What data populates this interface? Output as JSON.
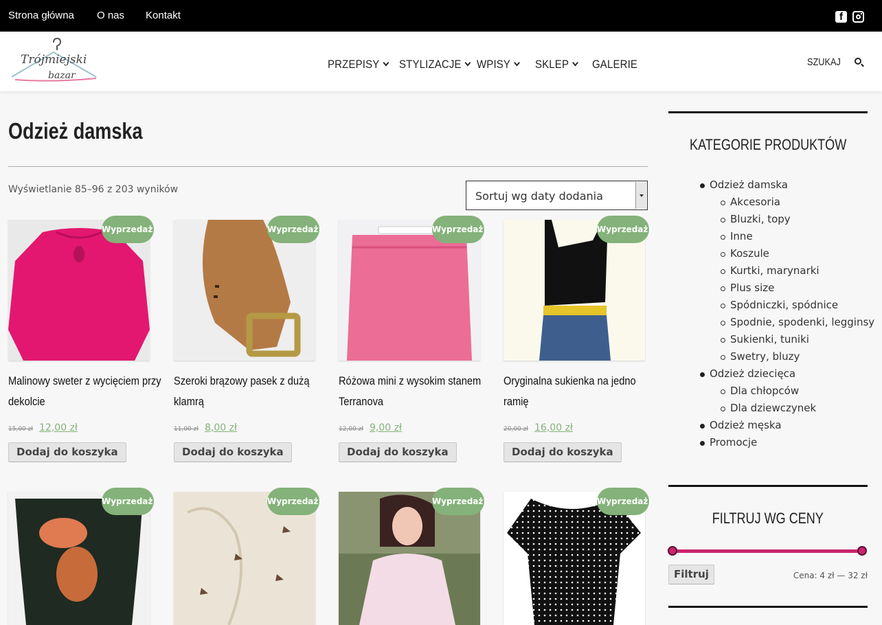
{
  "topbar": {
    "links": [
      "Strona główna",
      "O nas",
      "Kontakt"
    ],
    "social": [
      "facebook-icon",
      "instagram-icon"
    ]
  },
  "header": {
    "logo": {
      "line1": "Trójmiejski",
      "line2": "bazar"
    },
    "nav": [
      "PRZEPISY",
      "STYLIZACJE",
      "WPISY",
      "SKLEP",
      "GALERIE"
    ],
    "search_label": "SZUKAJ"
  },
  "main": {
    "title": "Odzież damska",
    "result_count": "Wyświetlanie 85–96 z 203 wyników",
    "sort_value": "Sortuj wg daty dodania",
    "sale_badge": "Wyprzedaż!",
    "add_to_cart": "Dodaj do koszyka",
    "products": [
      {
        "title_lines": [
          "Malinowy sweter z wycięciem przy",
          "dekolcie"
        ],
        "old_price": "15,00 zł",
        "price": "12,00 zł"
      },
      {
        "title_lines": [
          "Szeroki brązowy pasek z dużą",
          "klamrą"
        ],
        "old_price": "11,00 zł",
        "price": "8,00 zł"
      },
      {
        "title_lines": [
          "Różowa mini z wysokim stanem",
          "Terranova"
        ],
        "old_price": "12,00 zł",
        "price": "9,00 zł"
      },
      {
        "title_lines": [
          "Oryginalna sukienka na jedno",
          "ramię"
        ],
        "old_price": "20,00 zł",
        "price": "16,00 zł"
      },
      {
        "title_lines": [],
        "old_price": "",
        "price": ""
      },
      {
        "title_lines": [],
        "old_price": "",
        "price": ""
      },
      {
        "title_lines": [],
        "old_price": "",
        "price": ""
      },
      {
        "title_lines": [],
        "old_price": "",
        "price": ""
      }
    ]
  },
  "sidebar": {
    "categories_title": "KATEGORIE PRODUKTÓW",
    "categories": [
      {
        "label": "Odzież damska",
        "level": 0
      },
      {
        "label": "Akcesoria",
        "level": 1
      },
      {
        "label": "Bluzki, topy",
        "level": 1
      },
      {
        "label": "Inne",
        "level": 1
      },
      {
        "label": "Koszule",
        "level": 1
      },
      {
        "label": "Kurtki, marynarki",
        "level": 1
      },
      {
        "label": "Plus size",
        "level": 1
      },
      {
        "label": "Spódniczki, spódnice",
        "level": 1
      },
      {
        "label": "Spodnie, spodenki, legginsy",
        "level": 1
      },
      {
        "label": "Sukienki, tuniki",
        "level": 1
      },
      {
        "label": "Swetry, bluzy",
        "level": 1
      },
      {
        "label": "Odzież dziecięca",
        "level": 0
      },
      {
        "label": "Dla chłopców",
        "level": 1
      },
      {
        "label": "Dla dziewczynek",
        "level": 1
      },
      {
        "label": "Odzież męska",
        "level": 0
      },
      {
        "label": "Promocje",
        "level": 0
      }
    ],
    "price_filter_title": "FILTRUJ WG CENY",
    "filter_button": "Filtruj",
    "price_range_text": "Cena: 4 zł — 32 zł",
    "price_min": 4,
    "price_max": 32
  },
  "colors": {
    "accent_green": "#84b27a",
    "slider_pink": "#c9246d",
    "topbar_bg": "#000000"
  }
}
